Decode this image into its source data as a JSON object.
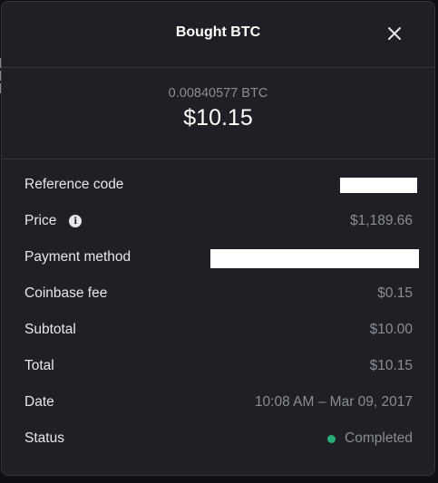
{
  "modal": {
    "title": "Bought BTC",
    "close_icon": "close-icon"
  },
  "summary": {
    "crypto_amount": "0.00840577 BTC",
    "fiat_amount": "$10.15"
  },
  "details": {
    "reference_code": {
      "label": "Reference code",
      "value_redacted": true
    },
    "price": {
      "label": "Price",
      "info_icon": "info-icon",
      "value": "$1,189.66"
    },
    "payment_method": {
      "label": "Payment method",
      "value_redacted": true
    },
    "coinbase_fee": {
      "label": "Coinbase fee",
      "value": "$0.15"
    },
    "subtotal": {
      "label": "Subtotal",
      "value": "$10.00"
    },
    "total": {
      "label": "Total",
      "value": "$10.15"
    },
    "date": {
      "label": "Date",
      "value": "10:08 AM – Mar 09, 2017"
    },
    "status": {
      "label": "Status",
      "value": "Completed",
      "status_color": "#27ad75"
    }
  },
  "colors": {
    "background": "#1e2025",
    "border": "#33363d",
    "muted_text": "#8a8d94",
    "primary_text": "#ffffff"
  }
}
